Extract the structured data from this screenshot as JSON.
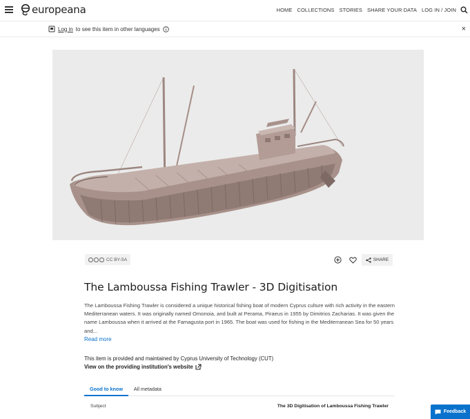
{
  "header": {
    "logo_text": "europeana",
    "nav": [
      "HOME",
      "COLLECTIONS",
      "STORIES",
      "SHARE YOUR DATA",
      "LOG IN / JOIN"
    ]
  },
  "banner": {
    "login_link": "Log in",
    "message": "to see this item in other languages",
    "close": "×"
  },
  "item": {
    "license": "CC BY-SA",
    "share_label": "SHARE",
    "title": "The Lamboussa Fishing Trawler - 3D Digitisation",
    "description": "The Lamboussa Fishing Trawler is considered a unique historical fishing boat of modern Cyprus culture with rich activity in the eastern Mediterranean waters. It was originally named Omonoia, and built at Perama, Piraeus in 1955 by Dimitrios Zacharias. It was given the name Lamboussa when it arrived at the Famagusta port in 1965. The boat was used for fishing in the Mediterranean Sea for 50 years and...",
    "read_more": "Read more",
    "provided_by": "This item is provided and maintained by Cyprus University of Technology (CUT)",
    "provider_link": "View on the providing institution's website"
  },
  "tabs": [
    "Good to know",
    "All metadata"
  ],
  "metadata_rows": [
    {
      "label": "Subject",
      "value": "The 3D Digitisation of Lamboussa Fishing Trawler"
    }
  ],
  "feedback_label": "Feedback",
  "colors": {
    "accent": "#0a72cc",
    "hull": "#a58d86",
    "viewer_bg": "#ebebeb"
  }
}
